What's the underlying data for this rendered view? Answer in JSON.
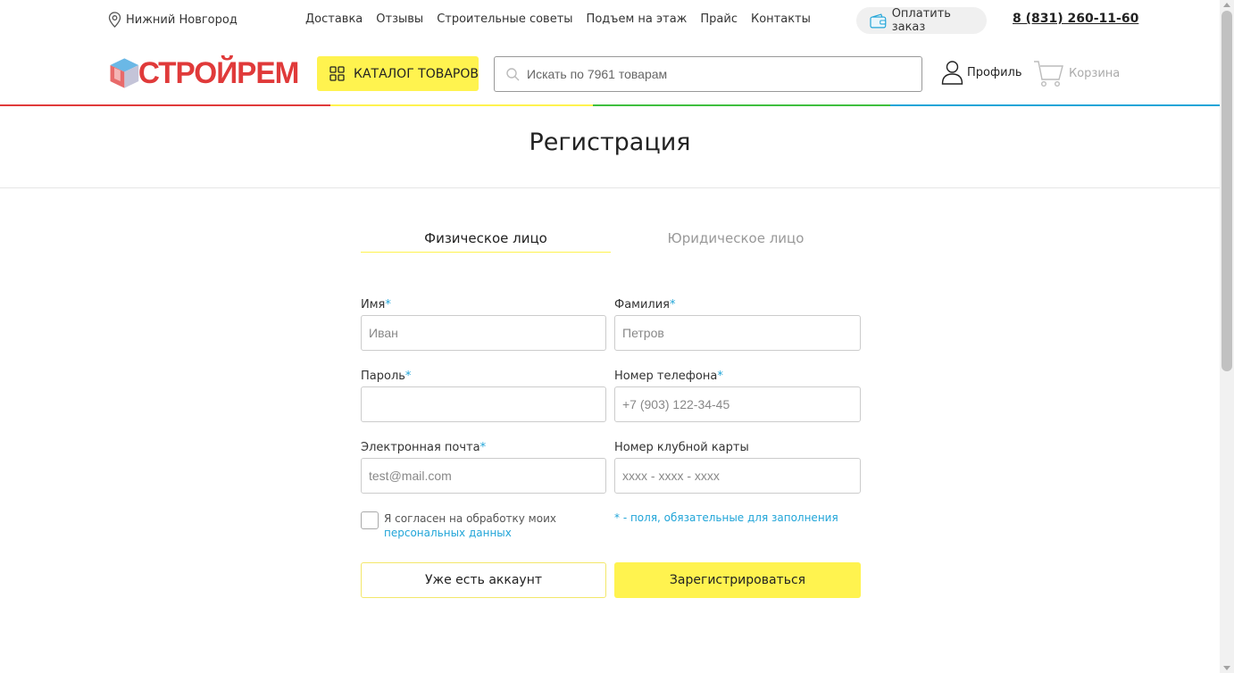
{
  "topbar": {
    "city": "Нижний Новгород",
    "nav": [
      "Доставка",
      "Отзывы",
      "Строительные советы",
      "Подъем на этаж",
      "Прайс",
      "Контакты"
    ],
    "pay_label": "Оплатить заказ",
    "phone": "8 (831) 260-11-60"
  },
  "header": {
    "logo_text": "СТРОЙРЕМ",
    "catalog_label": "КАТАЛОГ ТОВАРОВ",
    "search_placeholder": "Искать по 7961 товарам",
    "profile_label": "Профиль",
    "cart_label": "Корзина"
  },
  "colors": {
    "accent_yellow": "#fff34f",
    "link_blue": "#21a5d8",
    "stripe": [
      "#e03a3a",
      "#fff34f",
      "#3fbf3f",
      "#21a5d8"
    ]
  },
  "page": {
    "title": "Регистрация"
  },
  "tabs": [
    {
      "label": "Физическое лицо",
      "active": true
    },
    {
      "label": "Юридическое лицо",
      "active": false
    }
  ],
  "form": {
    "first_name": {
      "label": "Имя",
      "required_mark": "*",
      "placeholder": "Иван"
    },
    "last_name": {
      "label": "Фамилия",
      "required_mark": "*",
      "placeholder": "Петров"
    },
    "password": {
      "label": "Пароль",
      "required_mark": "*",
      "placeholder": ""
    },
    "phone": {
      "label": "Номер телефона",
      "required_mark": "*",
      "placeholder": "+7 (903) 122-34-45"
    },
    "email": {
      "label": "Электронная почта",
      "required_mark": "*",
      "placeholder": "test@mail.com"
    },
    "club_card": {
      "label": "Номер клубной карты",
      "placeholder": "xxxx - xxxx - xxxx"
    },
    "agree_text": "Я согласен на обработку моих",
    "agree_link": "персональных данных",
    "required_note": "* - поля, обязательные для заполнения",
    "login_button": "Уже есть аккаунт",
    "register_button": "Зарегистрироваться"
  }
}
